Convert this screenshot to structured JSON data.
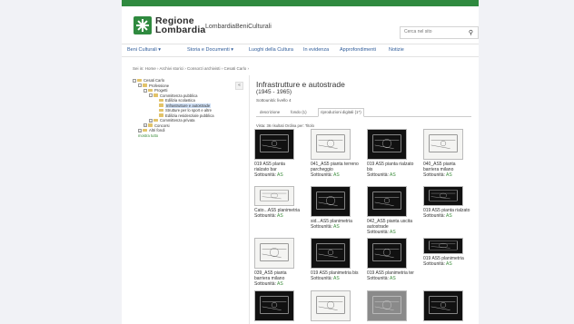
{
  "header": {
    "brand_line1": "Regione",
    "brand_line2": "Lombardia",
    "site_name": "LombardiaBeniCulturali",
    "search_placeholder": "Cerca nel sito"
  },
  "nav": [
    {
      "label": "Beni Culturali  ▾",
      "name": "nav-beni-culturali"
    },
    {
      "label": "Storia e Documenti  ▾",
      "name": "nav-storia-documenti"
    },
    {
      "label": "Luoghi della Cultura",
      "name": "nav-luoghi-cultura"
    },
    {
      "label": "In evidenza",
      "name": "nav-in-evidenza"
    },
    {
      "label": "Approfondimenti",
      "name": "nav-approfondimenti"
    },
    {
      "label": "Notizie",
      "name": "nav-notizie"
    }
  ],
  "breadcrumb": "Sei in: Home › Archivi storici › Consorzi archivisti › Cesati Carlo ›",
  "tree": [
    {
      "label": "Cesati Carlo",
      "level": 0,
      "exp": "-"
    },
    {
      "label": "Professione",
      "level": 1,
      "exp": "-"
    },
    {
      "label": "Progetti",
      "level": 2,
      "exp": "-"
    },
    {
      "label": "Committenza pubblica",
      "level": 3,
      "exp": "-"
    },
    {
      "label": "Edilizia scolastica",
      "level": 4,
      "exp": ""
    },
    {
      "label": "Infrastrutture e autostrade",
      "level": 4,
      "exp": "",
      "selected": true
    },
    {
      "label": "Strutture per lo sport e altre",
      "level": 4,
      "exp": ""
    },
    {
      "label": "Edilizia residenziale pubblica",
      "level": 4,
      "exp": ""
    },
    {
      "label": "Committenza privata",
      "level": 3,
      "exp": "+"
    },
    {
      "label": "Concorsi",
      "level": 2,
      "exp": "+"
    },
    {
      "label": "Altri fondi",
      "level": 1,
      "exp": "+"
    },
    {
      "label": "mostra tutto",
      "level": 0,
      "exp": "",
      "green": true
    }
  ],
  "collapse_label": "«",
  "content": {
    "title": "Infrastrutture e autostrade",
    "dates": "(1945 - 1965)",
    "meta": "Sottounità: livello 4",
    "tabs": [
      "descrizione",
      "fondo (1)",
      "riproduzioni digitali (1*)"
    ],
    "active_tab": 2,
    "subtoolbar": "Vista: 36 risultati    Ordina per: Titolo"
  },
  "cards": [
    {
      "title": "019 AS5 planta",
      "sub1": "rialzato bar",
      "sub2": "Sottounità: ",
      "badge": "AS"
    },
    {
      "title": "041_AS5 pianta terreno",
      "sub1": "parcheggio",
      "sub2": "Sottounità: ",
      "badge": "AS"
    },
    {
      "title": "019 AS5 pianta rialzato",
      "sub1": "bis",
      "sub2": "Sottounità: ",
      "badge": "AS"
    },
    {
      "title": "040_AS5 pianta",
      "sub1": "barriera milano",
      "sub2": "Sottounità: ",
      "badge": "AS"
    },
    {
      "title": "Cato...AS5 planimetria",
      "sub1": "Sottounità: ",
      "badge": "AS"
    },
    {
      "title": "sid...AS5 planimetria",
      "sub1": "Sottounità: ",
      "badge": "AS"
    },
    {
      "title": "042_AS5 pianta uscita",
      "sub1": "autostrade",
      "sub2": "Sottounità: ",
      "badge": "AS"
    },
    {
      "title": "019 AS5 pianta rialzato",
      "sub1": "Sottounità: ",
      "badge": "AS"
    },
    {
      "title": "039_AS5 pianta",
      "sub1": "barriera milano",
      "sub2": "Sottounità: ",
      "badge": "AS"
    },
    {
      "title": "019 AS5 planimetria bis",
      "sub1": "Sottounità: ",
      "badge": "AS"
    },
    {
      "title": "019 AS5 planimetria ter",
      "sub1": "Sottounità: ",
      "badge": "AS"
    },
    {
      "title": "019 AS5 planimetria",
      "sub1": "Sottounità: ",
      "badge": "AS"
    },
    {
      "title": "",
      "sub1": "",
      "badge": ""
    },
    {
      "title": "",
      "sub1": "",
      "badge": ""
    },
    {
      "title": "",
      "sub1": "",
      "badge": ""
    },
    {
      "title": "",
      "sub1": "",
      "badge": ""
    }
  ],
  "icons": {
    "logo": "lombardia-rose-icon",
    "search": "magnifier-icon",
    "folder": "folder-icon"
  },
  "colors": {
    "brand_green": "#2f8a3f",
    "link_blue": "#2f5c9a",
    "badge_green": "#3a8b3a",
    "selection": "#cfe0f6"
  }
}
